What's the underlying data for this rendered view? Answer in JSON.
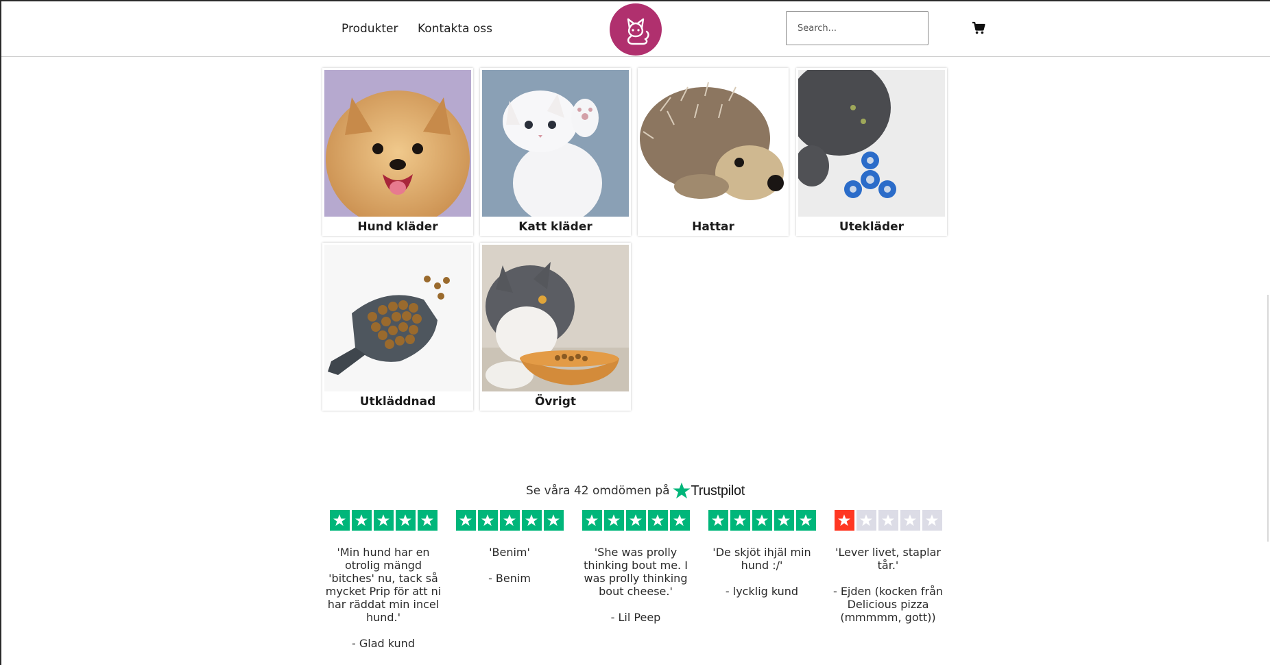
{
  "nav": {
    "products_label": "Produkter",
    "contact_label": "Kontakta oss",
    "search_placeholder": "Search...",
    "search_value": "",
    "brand_color": "#b0306e"
  },
  "categories": [
    {
      "label": "Hund kläder",
      "image": "pomeranian-dog-photo"
    },
    {
      "label": "Katt kläder",
      "image": "white-kitten-photo"
    },
    {
      "label": "Hattar",
      "image": "plush-hedgehog-photo"
    },
    {
      "label": "Utekläder",
      "image": "cat-with-fidget-spinner-photo"
    },
    {
      "label": "Utkläddnad",
      "image": "scoop-of-pet-food-photo"
    },
    {
      "label": "Övrigt",
      "image": "cat-eating-from-bowl-photo"
    }
  ],
  "trustpilot": {
    "headline": "Se våra 42 omdömen på",
    "brand": "Trustpilot",
    "green": "#00b67a",
    "red": "#ff3722",
    "empty": "#dcdce6"
  },
  "reviews": [
    {
      "stars": 5,
      "text": "'Min hund har en otrolig mängd 'bitches' nu, tack så mycket Prip för att ni har räddat min incel hund.'",
      "author": "- Glad kund"
    },
    {
      "stars": 5,
      "text": "'Benim'",
      "author": "- Benim"
    },
    {
      "stars": 5,
      "text": "'She was prolly thinking bout me. I was prolly thinking bout cheese.'",
      "author": "- Lil Peep"
    },
    {
      "stars": 5,
      "text": "'De skjöt ihjäl min hund :/'",
      "author": "- lycklig kund"
    },
    {
      "stars": 1,
      "text": "'Lever livet, staplar tår.'",
      "author": "- Ejden (kocken från Delicious pizza (mmmmm, gott))"
    }
  ]
}
